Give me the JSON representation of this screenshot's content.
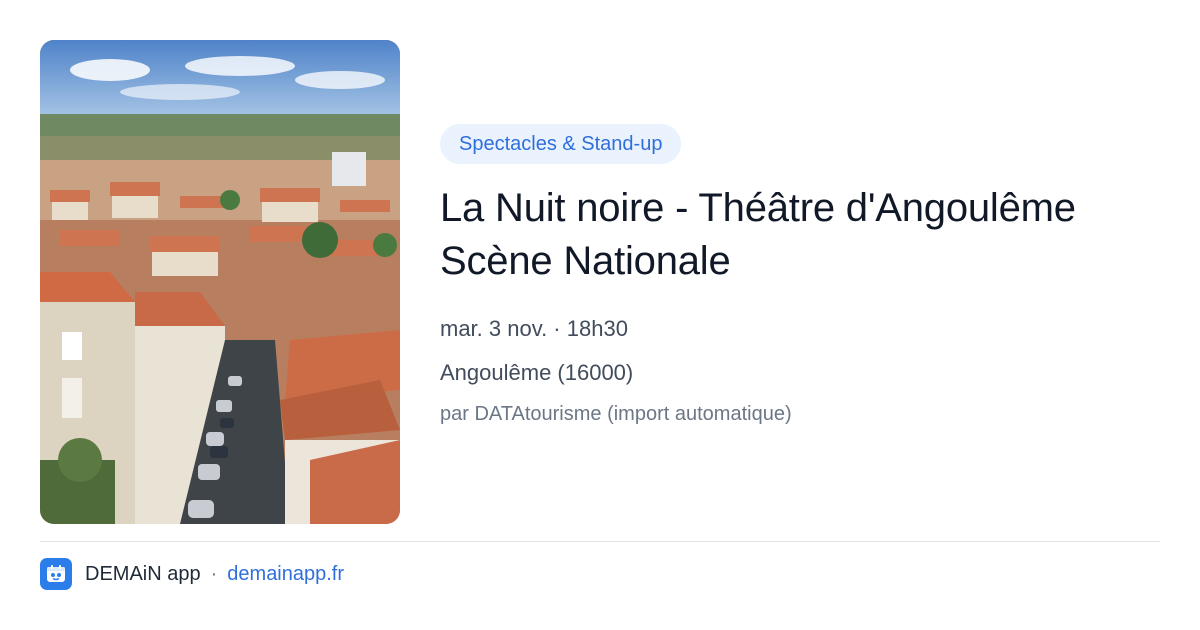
{
  "card": {
    "image_alt": "Vue sur les toits d'Angoulême",
    "category": "Spectacles & Stand-up",
    "title_line1": "La Nuit noire - Théâtre d'Angoulême",
    "title_line2": "Scène Nationale",
    "date": "mar. 3 nov. · 18h30",
    "location": "Angoulême (16000)",
    "source": "par DATAtourisme (import automatique)"
  },
  "footer": {
    "app_name": "DEMAiN app",
    "separator": "·",
    "url": "demainapp.fr"
  },
  "colors": {
    "accent": "#2f6fdb",
    "badge_bg": "#e9f2fd",
    "title": "#111827",
    "muted": "#6b7787"
  }
}
